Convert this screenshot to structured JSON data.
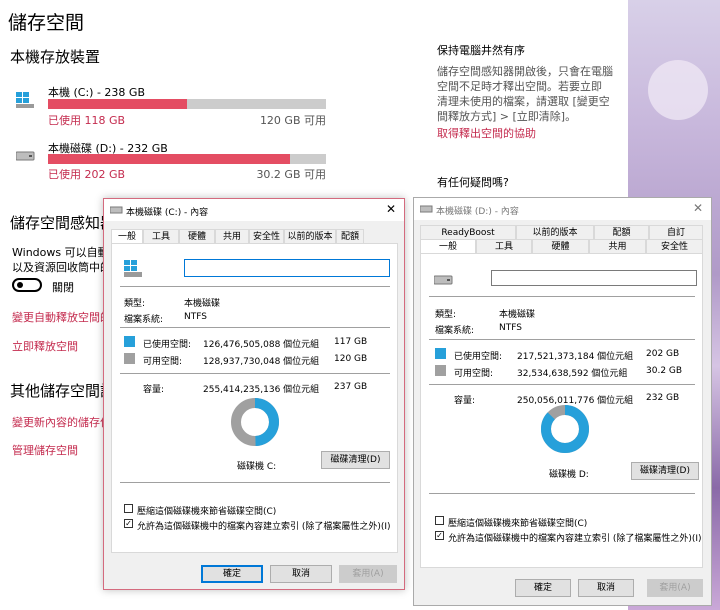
{
  "settings": {
    "title": "儲存空間",
    "local_storage_heading": "本機存放裝置",
    "drives": [
      {
        "name": "本機 (C:) - 238 GB",
        "used": "已使用 118 GB",
        "free": "120 GB 可用",
        "fill": 0.5
      },
      {
        "name": "本機磁碟 (D:) - 232 GB",
        "used": "已使用 202 GB",
        "free": "30.2 GB 可用",
        "fill": 0.87
      }
    ],
    "sense_heading": "儲存空間感知器",
    "sense_desc_1": "Windows 可以自動",
    "sense_desc_2": "以及資源回收筒中的",
    "toggle_state": "關閉",
    "sense_link_change": "變更自動釋放空間的",
    "sense_link_free": "立即釋放空間",
    "other_heading": "其他儲存空間設",
    "other_link_change": "變更新內容的儲存位",
    "other_link_manage": "管理儲存空間",
    "right_heading": "保持電腦井然有序",
    "right_desc": [
      "儲存空間感知器開啟後，只會在電腦",
      "空間不足時才釋出空間。若要立即",
      "清理未使用的檔案，請選取 [變更空",
      "間釋放方式] > [立即清除]。"
    ],
    "right_link": "取得釋出空間的協助",
    "question_heading": "有任何疑問嗎?"
  },
  "dialog_c": {
    "title": "本機磁碟 (C:) - 內容",
    "close": "✕",
    "tabs": [
      "一般",
      "工具",
      "硬體",
      "共用",
      "安全性",
      "以前的版本",
      "配額"
    ],
    "name_value": "",
    "type_label": "類型:",
    "type_value": "本機磁碟",
    "fs_label": "檔案系統:",
    "fs_value": "NTFS",
    "used_label": "已使用空間:",
    "used_bytes": "126,476,505,088 個位元組",
    "used_gb": "117 GB",
    "free_label": "可用空間:",
    "free_bytes": "128,937,730,048 個位元組",
    "free_gb": "120 GB",
    "cap_label": "容量:",
    "cap_bytes": "255,414,235,136 個位元組",
    "cap_gb": "237 GB",
    "used_fraction": 0.495,
    "drive_label": "磁碟機 C:",
    "cleanup": "磁碟清理(D)",
    "compress": "壓縮這個磁碟機來節省磁碟空間(C)",
    "index": "允許為這個磁碟機中的檔案內容建立索引 (除了檔案屬性之外)(I)",
    "compress_checked": false,
    "index_checked": true,
    "ok": "確定",
    "cancel": "取消",
    "apply": "套用(A)"
  },
  "dialog_d": {
    "title": "本機磁碟 (D:) - 內容",
    "close": "✕",
    "tabs_row1": [
      "ReadyBoost",
      "以前的版本",
      "配額",
      "自訂"
    ],
    "tabs_row2": [
      "一般",
      "工具",
      "硬體",
      "共用",
      "安全性"
    ],
    "name_value": "",
    "type_label": "類型:",
    "type_value": "本機磁碟",
    "fs_label": "檔案系統:",
    "fs_value": "NTFS",
    "used_label": "已使用空間:",
    "used_bytes": "217,521,373,184 個位元組",
    "used_gb": "202 GB",
    "free_label": "可用空間:",
    "free_bytes": "32,534,638,592 個位元組",
    "free_gb": "30.2 GB",
    "cap_label": "容量:",
    "cap_bytes": "250,056,011,776 個位元組",
    "cap_gb": "232 GB",
    "used_fraction": 0.87,
    "drive_label": "磁碟機 D:",
    "cleanup": "磁碟清理(D)",
    "compress": "壓縮這個磁碟機來節省磁碟空間(C)",
    "index": "允許為這個磁碟機中的檔案內容建立索引 (除了檔案屬性之外)(I)",
    "compress_checked": false,
    "index_checked": true,
    "ok": "確定",
    "cancel": "取消",
    "apply": "套用(A)"
  },
  "colors": {
    "accent_red": "#c42b4e",
    "bar_red": "#e44d63",
    "used_blue": "#26a0da",
    "free_grey": "#a0a0a0",
    "focus_blue": "#0078d7"
  },
  "icons": {
    "drive": "hard-drive-icon",
    "windows_drive": "windows-drive-icon",
    "close": "close-icon",
    "toggle": "toggle-switch"
  }
}
